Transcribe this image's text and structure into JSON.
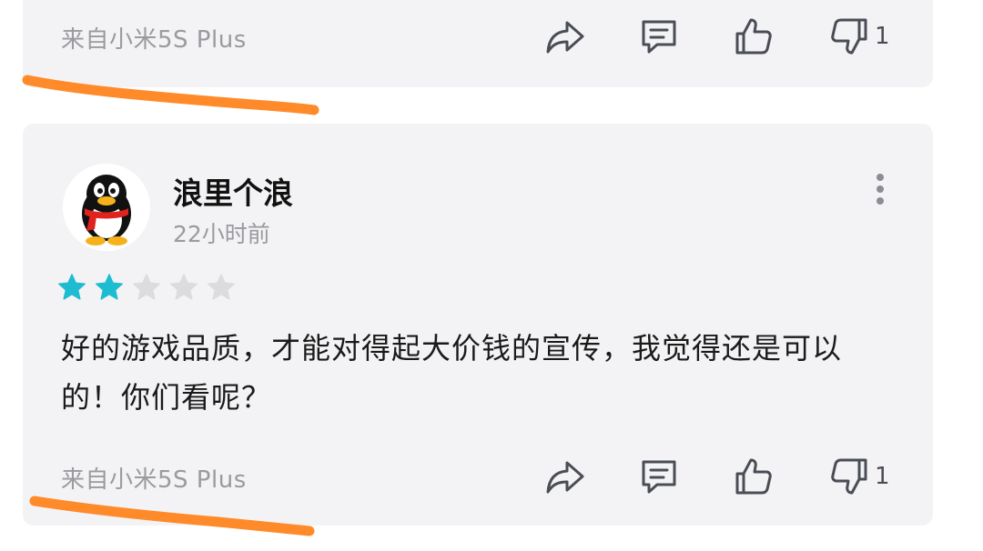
{
  "colors": {
    "card_bg": "#f3f3f5",
    "star_filled": "#1ebcd0",
    "star_empty": "#dcdcdf",
    "highlight_stroke": "#ff8a2a",
    "icon": "#4a4d55",
    "muted_text": "#9a9a9f"
  },
  "previous_review": {
    "device": "来自小米5S Plus",
    "actions": {
      "share_icon": "share-arrow-icon",
      "comment_icon": "comment-bubble-icon",
      "like_icon": "thumbs-up-icon",
      "dislike_icon": "thumbs-down-icon",
      "dislike_count": "1"
    }
  },
  "review": {
    "avatar_icon": "qq-penguin-avatar",
    "username": "浪里个浪",
    "timestamp": "22小时前",
    "rating": 2,
    "rating_max": 5,
    "text": "好的游戏品质，才能对得起大价钱的宣传，我觉得还是可以的！你们看呢？",
    "device": "来自小米5S Plus",
    "more_icon": "more-vertical-icon",
    "actions": {
      "share_icon": "share-arrow-icon",
      "comment_icon": "comment-bubble-icon",
      "like_icon": "thumbs-up-icon",
      "dislike_icon": "thumbs-down-icon",
      "dislike_count": "1"
    }
  }
}
